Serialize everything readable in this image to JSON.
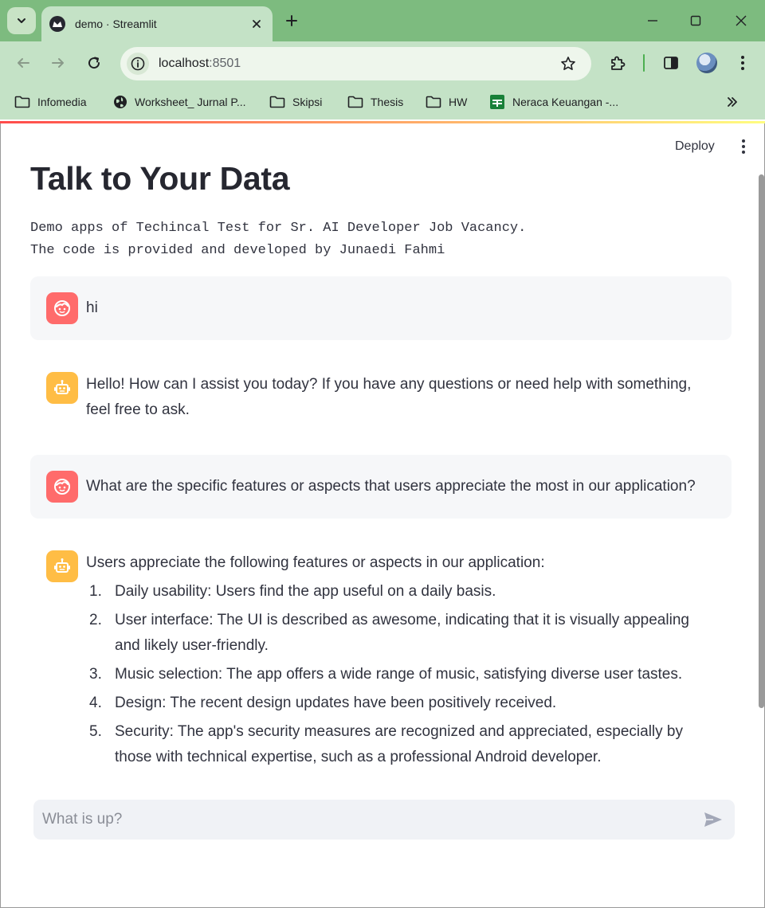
{
  "browser": {
    "tab_title": "demo · Streamlit",
    "url_host": "localhost",
    "url_port": ":8501",
    "bookmarks": [
      {
        "label": "Infomedia",
        "icon": "folder-icon"
      },
      {
        "label": "Worksheet_ Jurnal P...",
        "icon": "globe-icon"
      },
      {
        "label": "Skipsi",
        "icon": "folder-icon"
      },
      {
        "label": "Thesis",
        "icon": "folder-icon"
      },
      {
        "label": "HW",
        "icon": "folder-icon"
      },
      {
        "label": "Neraca Keuangan -...",
        "icon": "sheets-icon"
      }
    ]
  },
  "app": {
    "deploy_label": "Deploy",
    "title": "Talk to Your Data",
    "description": "Demo apps of Techincal Test for Sr. AI Developer Job Vacancy.\nThe code is provided and developed by Junaedi Fahmi",
    "messages": [
      {
        "role": "user",
        "text": "hi"
      },
      {
        "role": "assistant",
        "text": "Hello! How can I assist you today? If you have any questions or need help with something, feel free to ask."
      },
      {
        "role": "user",
        "text": "What are the specific features or aspects that users appreciate the most in our application?"
      },
      {
        "role": "assistant",
        "intro": "Users appreciate the following features or aspects in our application:",
        "items": [
          {
            "num": "1.",
            "text": "Daily usability: Users find the app useful on a daily basis."
          },
          {
            "num": "2.",
            "text": "User interface: The UI is described as awesome, indicating that it is visually appealing and likely user-friendly."
          },
          {
            "num": "3.",
            "text": "Music selection: The app offers a wide range of music, satisfying diverse user tastes."
          },
          {
            "num": "4.",
            "text": "Design: The recent design updates have been positively received."
          },
          {
            "num": "5.",
            "text": "Security: The app's security measures are recognized and appreciated, especially by those with technical expertise, such as a professional Android developer."
          }
        ]
      }
    ],
    "chat_input": {
      "placeholder": "What is up?",
      "value": ""
    }
  },
  "colors": {
    "user_avatar": "#ff6b6b",
    "assistant_avatar": "#ffbd45",
    "chrome_frame": "#7dbb7f",
    "chrome_toolbar": "#c4e2c6"
  }
}
